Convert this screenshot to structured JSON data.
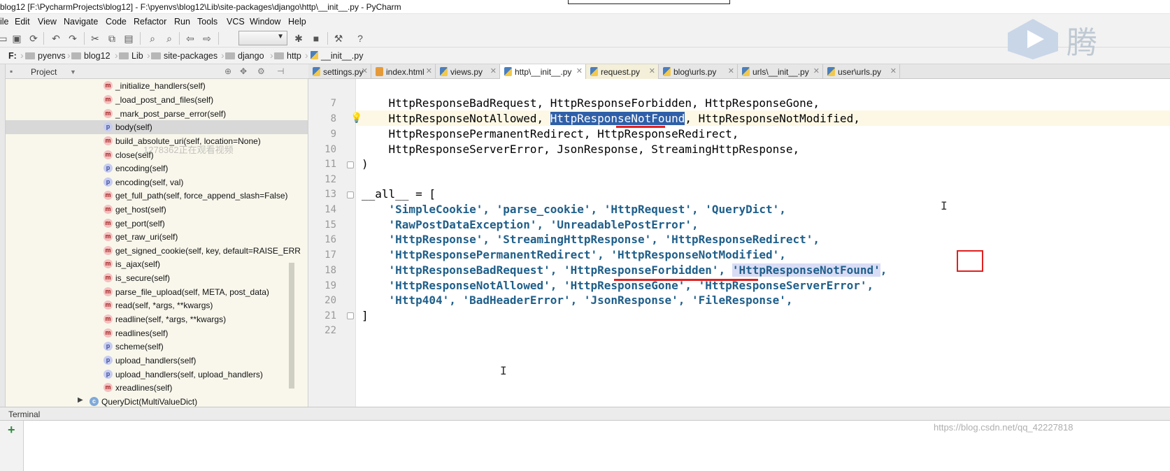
{
  "window": {
    "title": "blog12 [F:\\PycharmProjects\\blog12] - F:\\pyenvs\\blog12\\Lib\\site-packages\\django\\http\\__init__.py - PyCharm"
  },
  "menu": [
    "ile",
    "Edit",
    "View",
    "Navigate",
    "Code",
    "Refactor",
    "Run",
    "Tools",
    "VCS",
    "Window",
    "Help"
  ],
  "breadcrumbs": [
    "F:",
    "pyenvs",
    "blog12",
    "Lib",
    "site-packages",
    "django",
    "http",
    "__init__.py"
  ],
  "project_panel": {
    "title": "Project",
    "items": [
      {
        "kind": "m",
        "label": "_initialize_handlers(self)"
      },
      {
        "kind": "m",
        "label": "_load_post_and_files(self)"
      },
      {
        "kind": "m",
        "label": "_mark_post_parse_error(self)"
      },
      {
        "kind": "p",
        "label": "body(self)",
        "selected": true
      },
      {
        "kind": "m",
        "label": "build_absolute_uri(self, location=None)"
      },
      {
        "kind": "m",
        "label": "close(self)"
      },
      {
        "kind": "p",
        "label": "encoding(self)"
      },
      {
        "kind": "p",
        "label": "encoding(self, val)"
      },
      {
        "kind": "m",
        "label": "get_full_path(self, force_append_slash=False)"
      },
      {
        "kind": "m",
        "label": "get_host(self)"
      },
      {
        "kind": "m",
        "label": "get_port(self)"
      },
      {
        "kind": "m",
        "label": "get_raw_uri(self)"
      },
      {
        "kind": "m",
        "label": "get_signed_cookie(self, key, default=RAISE_ERR"
      },
      {
        "kind": "m",
        "label": "is_ajax(self)"
      },
      {
        "kind": "m",
        "label": "is_secure(self)"
      },
      {
        "kind": "m",
        "label": "parse_file_upload(self, META, post_data)"
      },
      {
        "kind": "m",
        "label": "read(self, *args, **kwargs)"
      },
      {
        "kind": "m",
        "label": "readline(self, *args, **kwargs)"
      },
      {
        "kind": "m",
        "label": "readlines(self)"
      },
      {
        "kind": "p",
        "label": "scheme(self)"
      },
      {
        "kind": "p",
        "label": "upload_handlers(self)"
      },
      {
        "kind": "p",
        "label": "upload_handlers(self, upload_handlers)"
      },
      {
        "kind": "m",
        "label": "xreadlines(self)"
      }
    ],
    "class_item": "QueryDict(MultiValueDict)",
    "overlay_text": "1278362正在观看视频"
  },
  "tabs": [
    {
      "label": "settings.py",
      "type": "py"
    },
    {
      "label": "index.html",
      "type": "html"
    },
    {
      "label": "views.py",
      "type": "py"
    },
    {
      "label": "http\\__init__.py",
      "type": "py",
      "active": true
    },
    {
      "label": "request.py",
      "type": "py"
    },
    {
      "label": "blog\\urls.py",
      "type": "py"
    },
    {
      "label": "urls\\__init__.py",
      "type": "py"
    },
    {
      "label": "user\\urls.py",
      "type": "py"
    }
  ],
  "editor": {
    "line_numbers": [
      "7",
      "8",
      "9",
      "10",
      "11",
      "12",
      "13",
      "14",
      "15",
      "16",
      "17",
      "18",
      "19",
      "20",
      "21",
      "22"
    ],
    "lines": {
      "l7": "    HttpResponseBadRequest, HttpResponseForbidden, HttpResponseGone,",
      "l8a": "    HttpResponseNotAllowed, ",
      "l8b": "HttpResponseNotFound",
      "l8c": ", HttpResponseNotModified,",
      "l9": "    HttpResponsePermanentRedirect, HttpResponseRedirect,",
      "l10": "    HttpResponseServerError, JsonResponse, StreamingHttpResponse,",
      "l11": ")",
      "l13a": "__all__ = [",
      "l14": "    'SimpleCookie', 'parse_cookie', 'HttpRequest', 'QueryDict',",
      "l15": "    'RawPostDataException', 'UnreadablePostError',",
      "l16": "    'HttpResponse', 'StreamingHttpResponse', 'HttpResponseRedirect',",
      "l17": "    'HttpResponsePermanentRedirect', 'HttpResponseNotModified',",
      "l18a": "    'HttpResponseBadRequest', 'HttpResponseForbidden', ",
      "l18b": "'HttpResponseNotFound'",
      "l18c": ",",
      "l19": "    'HttpResponseNotAllowed', 'HttpResponseGone', 'HttpResponseServerError',",
      "l20": "    'Http404', 'BadHeaderError', 'JsonResponse', 'FileResponse',",
      "l21": "]"
    }
  },
  "terminal": {
    "title": "Terminal"
  },
  "watermark": "https://blog.csdn.net/qq_42227818",
  "logo_text": "腾",
  "colors": {
    "selection": "#2f5fa8",
    "string": "#1f5f8a",
    "annotation_red": "#e02020",
    "project_bg": "#f9f7ec"
  }
}
